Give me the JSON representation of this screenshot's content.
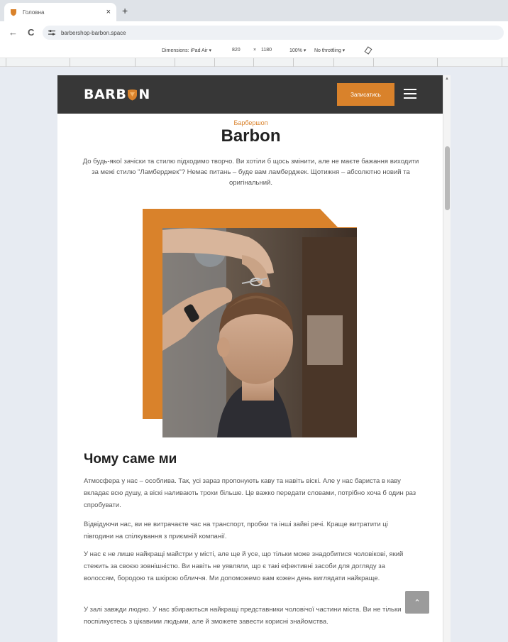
{
  "browser": {
    "tab_title": "Головна",
    "close_glyph": "×",
    "new_tab_glyph": "+",
    "back_glyph": "←",
    "reload_glyph": "C",
    "url": "barbershop-barbon.space"
  },
  "device_toolbar": {
    "dimensions": "Dimensions: iPad Air ▾",
    "width": "820",
    "x": "×",
    "height": "1180",
    "zoom": "100% ▾",
    "throttling": "No throttling ▾"
  },
  "site": {
    "logo_left": "BARB",
    "logo_right": "N",
    "cta_label": "Записатись",
    "kicker": "Барбершоп",
    "title": "Barbon",
    "intro": "До будь-якої зачіски та стилю підходимо творчо. Ви хотіли б щось змінити, але не маєте бажання виходити за межі стилю \"Ламберджек\"? Немає питань – буде вам ламберджек. Щотижня – абсолютно новий та оригінальний.",
    "section_title": "Чому саме ми",
    "paragraphs": [
      "Атмосфера у нас – особлива. Так, усі зараз пропонують каву та навіть віскі. Але у нас бариста в каву вкладає всю душу, а віскі наливають трохи більше. Це важко передати словами, потрібно хоча б один раз спробувати.",
      "Відвідуючи нас, ви не витрачаєте час на транспорт, пробки та інші зайві речі. Краще витратити ці півгодини на спілкування з приємній компанії.",
      "У нас є не лише найкращі майстри у місті, але ще й усе, що тільки може знадобитися чоловікові, який стежить за своєю зовнішністю. Ви навіть не уявляли, що є такі ефективні засоби для догляду за волоссям, бородою та шкірою обличчя. Ми допоможемо вам кожен день виглядати найкраще.",
      "У залі завжди людно. У нас збираються найкращі представники чоловічої частини міста. Ви не тільки поспілкуєтесь з цікавими людьми, але й зможете завести корисні знайомства."
    ],
    "back_to_top_glyph": "⌃"
  },
  "colors": {
    "accent": "#d9822b",
    "header_bg": "#373737"
  }
}
